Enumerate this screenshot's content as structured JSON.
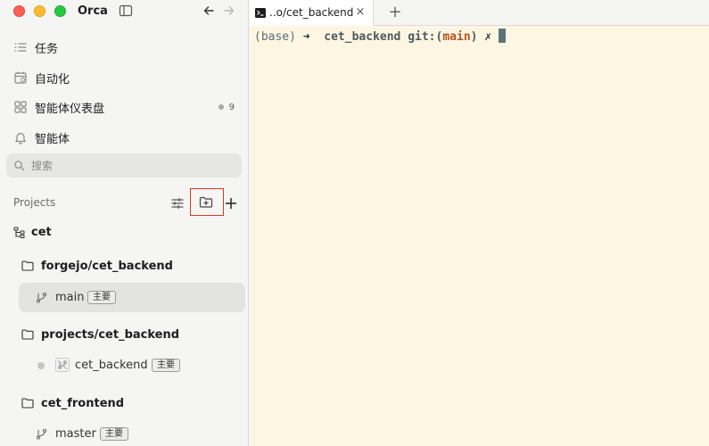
{
  "app": {
    "title": "Orca"
  },
  "sidebar": {
    "menu": [
      {
        "label": "任务",
        "icon": "list-icon"
      },
      {
        "label": "自动化",
        "icon": "calendar-icon"
      },
      {
        "label": "智能体仪表盘",
        "icon": "dashboard-icon",
        "count": "9"
      },
      {
        "label": "智能体",
        "icon": "bell-icon"
      }
    ],
    "search": {
      "placeholder": "搜索",
      "value": ""
    },
    "projects": {
      "header": "Projects",
      "root": {
        "label": "cet"
      },
      "groups": [
        {
          "folder": "forgejo/cet_backend",
          "items": [
            {
              "label": "main",
              "badge": "主要",
              "selected": true
            }
          ]
        },
        {
          "folder": "projects/cet_backend",
          "items": [
            {
              "label": "cet_backend",
              "badge": "主要",
              "selected": false
            }
          ]
        },
        {
          "folder": "cet_frontend",
          "items": [
            {
              "label": "master",
              "badge": "主要",
              "selected": false
            }
          ]
        }
      ]
    }
  },
  "tabs": [
    {
      "label": "..o/cet_backend",
      "icon": "terminal-icon"
    }
  ],
  "terminal": {
    "prompt_env": "(base)",
    "prompt_arrow": "➜",
    "dir": "cet_backend",
    "git_prefix": "git:(",
    "branch": "main",
    "git_suffix": ")",
    "dirty_mark": "✗"
  },
  "colors": {
    "terminal_bg": "#fdf6e3",
    "branch": "#b4521a",
    "highlight_border": "#d13b2b"
  }
}
